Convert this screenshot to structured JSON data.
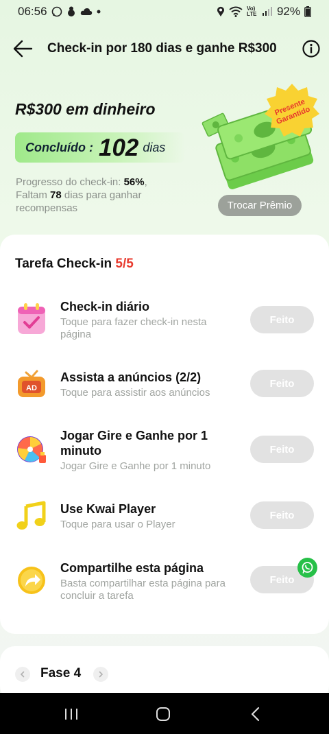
{
  "status_bar": {
    "time": "06:56",
    "battery": "92%",
    "network": "Vo) LTE"
  },
  "header": {
    "title": "Check-in por 180 dias e ganhe R$300"
  },
  "reward": {
    "title": "R$300 em dinheiro",
    "done_label": "Concluído :",
    "done_days": "102",
    "done_unit": "dias",
    "progress_prefix": "Progresso do check-in: ",
    "progress_percent": "56%",
    "progress_comma": ",",
    "remaining_prefix": "Faltam ",
    "remaining_days": "78",
    "remaining_suffix": " dias para ganhar recompensas",
    "badge_line1": "Presente",
    "badge_line2": "Garantido",
    "swap_button": "Trocar Prêmio"
  },
  "tasks": {
    "title": "Tarefa Check-in ",
    "count": "5/5",
    "items": [
      {
        "title": "Check-in diário",
        "subtitle": "Toque para fazer check-in nesta página",
        "button": "Feito",
        "icon": "calendar-icon"
      },
      {
        "title": "Assista a anúncios  (2/2)",
        "subtitle": "Toque para assistir aos anúncios",
        "button": "Feito",
        "icon": "ad-tv-icon"
      },
      {
        "title": "Jogar Gire e Ganhe por 1 minuto",
        "subtitle": "Jogar Gire e Ganhe por 1 minuto",
        "button": "Feito",
        "icon": "spin-wheel-icon"
      },
      {
        "title": "Use Kwai Player",
        "subtitle": "Toque para usar o Player",
        "button": "Feito",
        "icon": "music-note-icon"
      },
      {
        "title": "Compartilhe esta página",
        "subtitle": "Basta compartilhar esta página para concluir a tarefa",
        "button": "Feito",
        "icon": "share-arrow-icon"
      }
    ]
  },
  "phase": {
    "label": "Fase 4"
  },
  "colors": {
    "accent_green": "#9fe98a",
    "count_red": "#e83a2e",
    "done_button_gray": "#e2e2e2",
    "whatsapp_green": "#27c048"
  }
}
